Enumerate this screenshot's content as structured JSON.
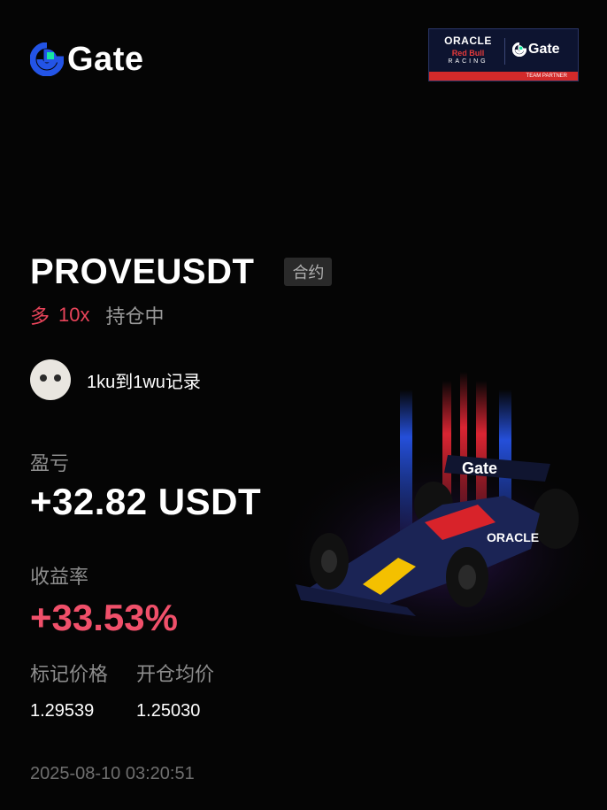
{
  "brand": {
    "logo_text": "Gate",
    "logo_icon": "gate-logo-icon"
  },
  "partner_badge": {
    "oracle": "ORACLE",
    "red_bull": "Red Bull",
    "racing": "RACING",
    "gate": "Gate",
    "team_partner": "TEAM PARTNER"
  },
  "position": {
    "pair": "PROVEUSDT",
    "type_badge": "合约",
    "direction": "多",
    "leverage": "10x",
    "status": "持仓中"
  },
  "user": {
    "name": "1ku到1wu记录"
  },
  "pnl": {
    "label": "盈亏",
    "value": "+32.82 USDT"
  },
  "roi": {
    "label": "收益率",
    "value": "+33.53%"
  },
  "prices": {
    "mark_label": "标记价格",
    "mark_value": "1.29539",
    "entry_label": "开仓均价",
    "entry_value": "1.25030"
  },
  "timestamp": "2025-08-10 03:20:51",
  "colors": {
    "background": "#050505",
    "profit": "#f0506a",
    "long": "#e8445a",
    "muted": "#8d8d8d",
    "brand_blue": "#2354e6",
    "brand_green": "#17e6a1"
  }
}
